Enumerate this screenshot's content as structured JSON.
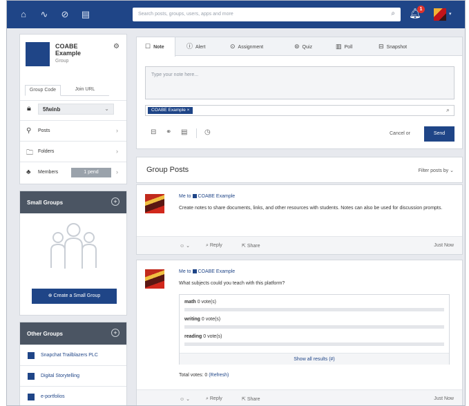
{
  "search": {
    "placeholder": "Search posts, groups, users, apps and more"
  },
  "topbar": {
    "notifications": "1"
  },
  "group": {
    "name": "COABE Example",
    "type": "Group",
    "tabs": [
      "Group Code",
      "Join URL"
    ],
    "code": "5fwinb",
    "menu": [
      {
        "label": "Posts",
        "icon": "search-icon"
      },
      {
        "label": "Folders",
        "icon": "folder-icon"
      },
      {
        "label": "Members",
        "icon": "members-icon",
        "pill": "1 pend"
      }
    ]
  },
  "small_groups": {
    "title": "Small Groups",
    "create_label": "Create a Small Group"
  },
  "other_groups": {
    "title": "Other Groups",
    "items": [
      "Snapchat Trailblazers PLC",
      "Digital Storytelling",
      "e-portfolios"
    ]
  },
  "composer": {
    "tabs": [
      "Note",
      "Alert",
      "Assignment",
      "Quiz",
      "Poll",
      "Snapshot"
    ],
    "placeholder": "Type your note here...",
    "recipient": "COABE Example",
    "cancel": "Cancel",
    "or": "or",
    "send": "Send"
  },
  "posts_header": {
    "title": "Group Posts",
    "filter": "Filter posts by"
  },
  "posts": [
    {
      "from": "Me to",
      "to": "COABE Example",
      "body": "Create notes to share documents, links, and other resources with students. Notes can also be used for discussion prompts.",
      "reply": "Reply",
      "share": "Share",
      "time": "Just Now"
    },
    {
      "from": "Me to",
      "to": "COABE Example",
      "body": "What subjects could you teach with this platform?",
      "poll": [
        {
          "answer": "math",
          "votes": "0 vote(s)"
        },
        {
          "answer": "writing",
          "votes": "0 vote(s)"
        },
        {
          "answer": "reading",
          "votes": "0 vote(s)"
        }
      ],
      "show_all": "Show all results (#)",
      "total": "Total votes: 0",
      "refresh": "(Refresh)",
      "reply": "Reply",
      "share": "Share",
      "time": "Just Now"
    }
  ],
  "colors": {
    "brand": "#1f4587",
    "panel_header": "#4b5563",
    "background": "#e7e9ee"
  }
}
